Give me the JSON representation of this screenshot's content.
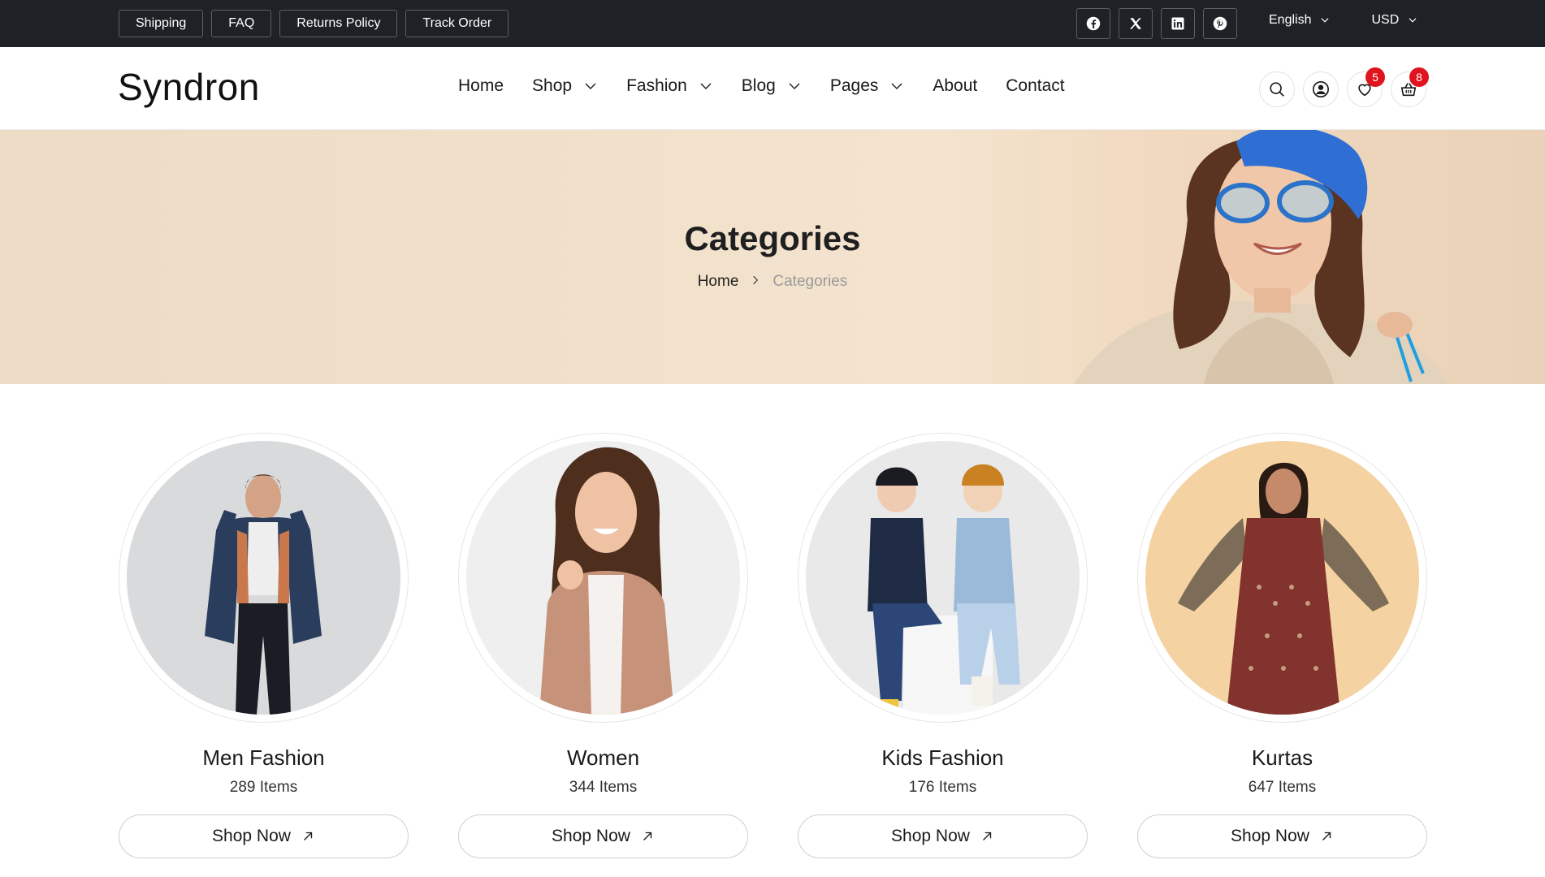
{
  "topbar": {
    "links": [
      "Shipping",
      "FAQ",
      "Returns Policy",
      "Track Order"
    ],
    "socials": [
      "facebook-icon",
      "x-icon",
      "linkedin-icon",
      "pinterest-icon"
    ],
    "language": "English",
    "currency": "USD"
  },
  "header": {
    "logo": "Syndron",
    "nav": [
      {
        "label": "Home",
        "dropdown": false
      },
      {
        "label": "Shop",
        "dropdown": true
      },
      {
        "label": "Fashion",
        "dropdown": true
      },
      {
        "label": "Blog",
        "dropdown": true
      },
      {
        "label": "Pages",
        "dropdown": true
      },
      {
        "label": "About",
        "dropdown": false
      },
      {
        "label": "Contact",
        "dropdown": false
      }
    ],
    "wishlist_count": "5",
    "cart_count": "8"
  },
  "hero": {
    "title": "Categories",
    "breadcrumb": {
      "home": "Home",
      "current": "Categories"
    }
  },
  "categories": [
    {
      "name": "Men Fashion",
      "count": "289 Items",
      "button": "Shop Now"
    },
    {
      "name": "Women",
      "count": "344 Items",
      "button": "Shop Now"
    },
    {
      "name": "Kids Fashion",
      "count": "176 Items",
      "button": "Shop Now"
    },
    {
      "name": "Kurtas",
      "count": "647 Items",
      "button": "Shop Now"
    }
  ],
  "colors": {
    "topbar_bg": "#1e2125",
    "badge": "#e0141e",
    "hero_bg": "#f1e1cb"
  }
}
